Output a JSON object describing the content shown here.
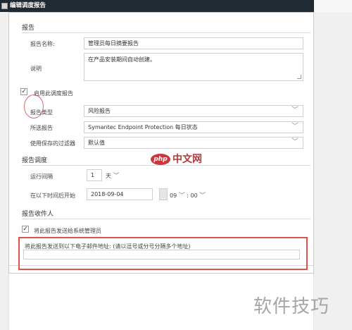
{
  "window": {
    "title": "编辑调度报告"
  },
  "sections": {
    "report": "报告",
    "schedule": "报告调度",
    "recipients": "报告收件人"
  },
  "report_name": {
    "label": "报告名称:",
    "value": "管理员每日摘要报告"
  },
  "description": {
    "label": "说明",
    "value": "在产品安装期间自动创建。"
  },
  "enable_schedule": {
    "label": "启用此调度报告",
    "checked": true
  },
  "report_type": {
    "label": "报告类型",
    "value": "风险报告"
  },
  "selected_report": {
    "label": "所选报告",
    "value": "Symantec Endpoint Protection 每日状态"
  },
  "saved_filter": {
    "label": "使用保存的过滤器",
    "value": "默认值"
  },
  "run_every": {
    "label": "运行间隔",
    "value": "1",
    "unit": "天"
  },
  "start_after": {
    "label": "在以下时间后开始",
    "date": "2018-09-04",
    "hour": "09",
    "minute": "00",
    "separator": ":"
  },
  "send_to_admin": {
    "label": "将此报告发送给系统管理员",
    "checked": true
  },
  "email": {
    "label": "将此报告发送到以下电子邮件地址: (请以逗号或分号分隔多个地址)",
    "value": ""
  },
  "watermarks": {
    "php_badge": "php",
    "php_cn": "中文网",
    "bottom": "软件技巧"
  },
  "colors": {
    "titlebar": "#1f2a33",
    "highlight": "#d9534f"
  }
}
